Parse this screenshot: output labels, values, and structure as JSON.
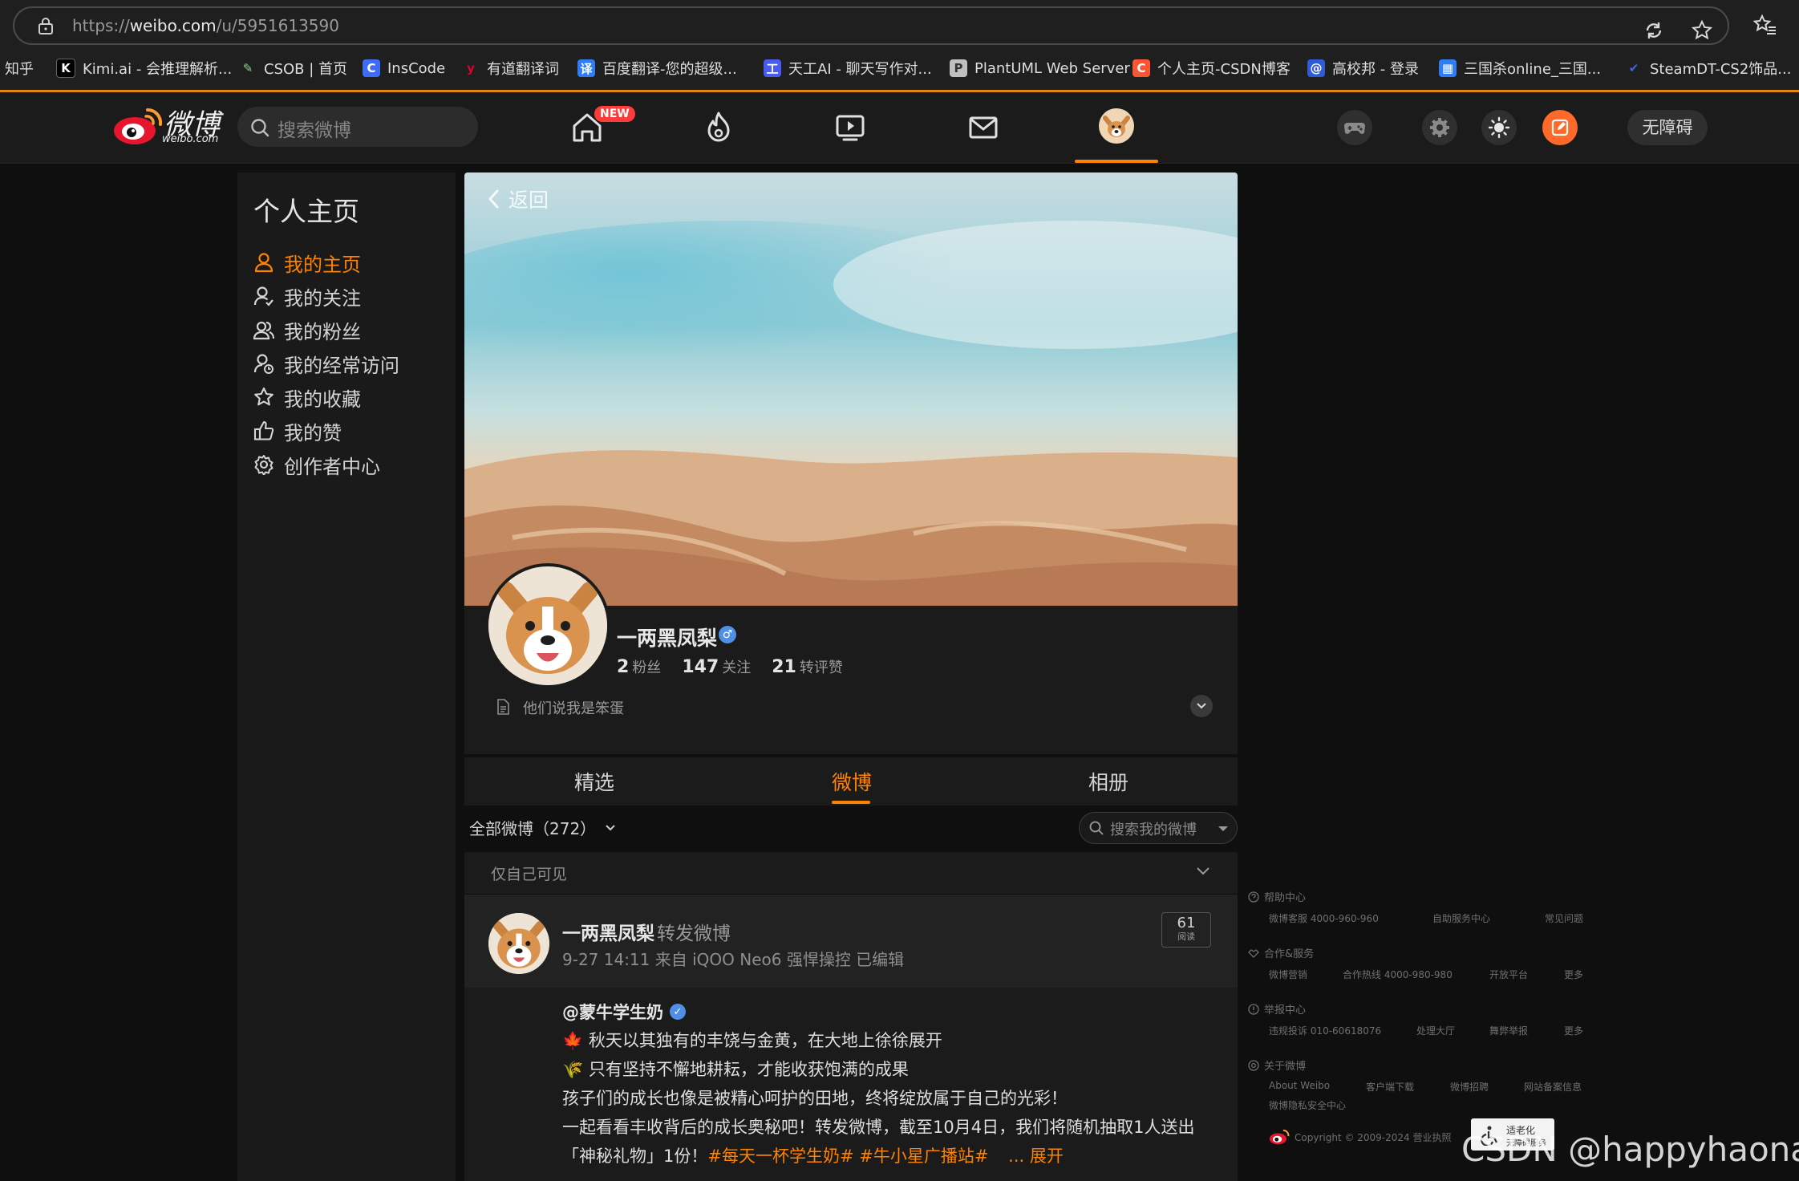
{
  "browser": {
    "url_prefix": "https://",
    "url_domain": "weibo.com",
    "url_path": "/u/5951613590",
    "bookmarks": [
      {
        "label": "知乎",
        "icon": "zhihu-favicon",
        "color": "#0066ff"
      },
      {
        "label": "Kimi.ai - 会推理解析...",
        "icon": "kimi-favicon",
        "color": "#000000"
      },
      {
        "label": "CSOB | 首页",
        "icon": "pen-favicon",
        "color": "#3b8a3b"
      },
      {
        "label": "InsCode",
        "icon": "inscode-favicon",
        "color": "#3e6cf6"
      },
      {
        "label": "有道翻译词",
        "icon": "youdao-favicon",
        "color": "#e0002a"
      },
      {
        "label": "百度翻译-您的超级...",
        "icon": "baidu-translate-favicon",
        "color": "#2f7cf6"
      },
      {
        "label": "天工AI - 聊天写作对...",
        "icon": "tiangong-favicon",
        "color": "#4a5cf0"
      },
      {
        "label": "PlantUML Web Server",
        "icon": "plantuml-favicon",
        "color": "#c0c0c0"
      },
      {
        "label": "个人主页-CSDN博客",
        "icon": "csdn-favicon",
        "color": "#fc5531"
      },
      {
        "label": "高校邦 - 登录",
        "icon": "gaoxiaobang-favicon",
        "color": "#2f5bd6"
      },
      {
        "label": "三国杀online_三国...",
        "icon": "sanguosha-favicon",
        "color": "#2f7cf6"
      },
      {
        "label": "SteamDT-CS2饰品...",
        "icon": "steamdt-favicon",
        "color": "#3a66e0"
      }
    ]
  },
  "topnav": {
    "logo_cn": "微博",
    "logo_en": "weibo.com",
    "search_placeholder": "搜索微博",
    "new_badge": "NEW",
    "accessibility": "无障碍",
    "accent": "#ff8200"
  },
  "sidebar": {
    "title": "个人主页",
    "items": [
      {
        "label": "我的主页",
        "icon": "person-icon",
        "active": true
      },
      {
        "label": "我的关注",
        "icon": "person-follow-icon",
        "active": false
      },
      {
        "label": "我的粉丝",
        "icon": "fans-icon",
        "active": false
      },
      {
        "label": "我的经常访问",
        "icon": "frequent-visit-icon",
        "active": false
      },
      {
        "label": "我的收藏",
        "icon": "star-icon",
        "active": false
      },
      {
        "label": "我的赞",
        "icon": "thumbs-up-icon",
        "active": false
      },
      {
        "label": "创作者中心",
        "icon": "gear-icon",
        "active": false
      }
    ]
  },
  "profile": {
    "back_label": "返回",
    "name": "一两黑凤梨",
    "gender_symbol": "♂",
    "stats": [
      {
        "value": "2",
        "label": "粉丝"
      },
      {
        "value": "147",
        "label": "关注"
      },
      {
        "value": "21",
        "label": "转评赞"
      }
    ],
    "bio": "他们说我是笨蛋"
  },
  "tabs": [
    {
      "label": "精选",
      "active": false
    },
    {
      "label": "微博",
      "active": true
    },
    {
      "label": "相册",
      "active": false
    }
  ],
  "feed": {
    "filter_label": "全部微博（272）",
    "search_placeholder": "搜索我的微博",
    "visibility": "仅自己可见"
  },
  "post": {
    "author": "一两黑凤梨",
    "action": "转发微博",
    "meta": "9-27 14:11  来自 iQOO Neo6 强悍操控  已编辑",
    "reads_count": "61",
    "reads_label": "阅读",
    "orig_author": "@蒙牛学生奶",
    "line1": "🍁 秋天以其独有的丰饶与金黄，在大地上徐徐展开",
    "line2": "🌾 只有坚持不懈地耕耘，才能收获饱满的成果",
    "line3": "孩子们的成长也像是被精心呵护的田地，终将绽放属于自己的光彩！",
    "line4": "一起看看丰收背后的成长奥秘吧！转发微博，截至10月4日，我们将随机抽取1人送出",
    "line5_text": "「神秘礼物」1份！",
    "hashtag1": "#每天一杯学生奶#",
    "hashtag2": "#牛小星广播站#",
    "more_label": "... 展开"
  },
  "footer": {
    "help_title": "帮助中心",
    "help_links": [
      "微博客服 4000-960-960",
      "自助服务中心",
      "常见问题"
    ],
    "coop_title": "合作&服务",
    "coop_links": [
      "微博营销",
      "合作热线 4000-980-980",
      "开放平台",
      "更多"
    ],
    "report_title": "举报中心",
    "report_links": [
      "违规投诉 010-60618076",
      "处理大厅",
      "舞弊举报",
      "更多"
    ],
    "about_title": "关于微博",
    "about_links": [
      "About Weibo",
      "客户端下载",
      "微博招聘",
      "网站备案信息"
    ],
    "privacy_link": "微博隐私安全中心",
    "copyright": "Copyright © 2009-2024 营业执照",
    "a11y_badge_line1": "适老化",
    "a11y_badge_line2": "无障碍服务",
    "watermark": "CSDN @happyhaonan"
  }
}
